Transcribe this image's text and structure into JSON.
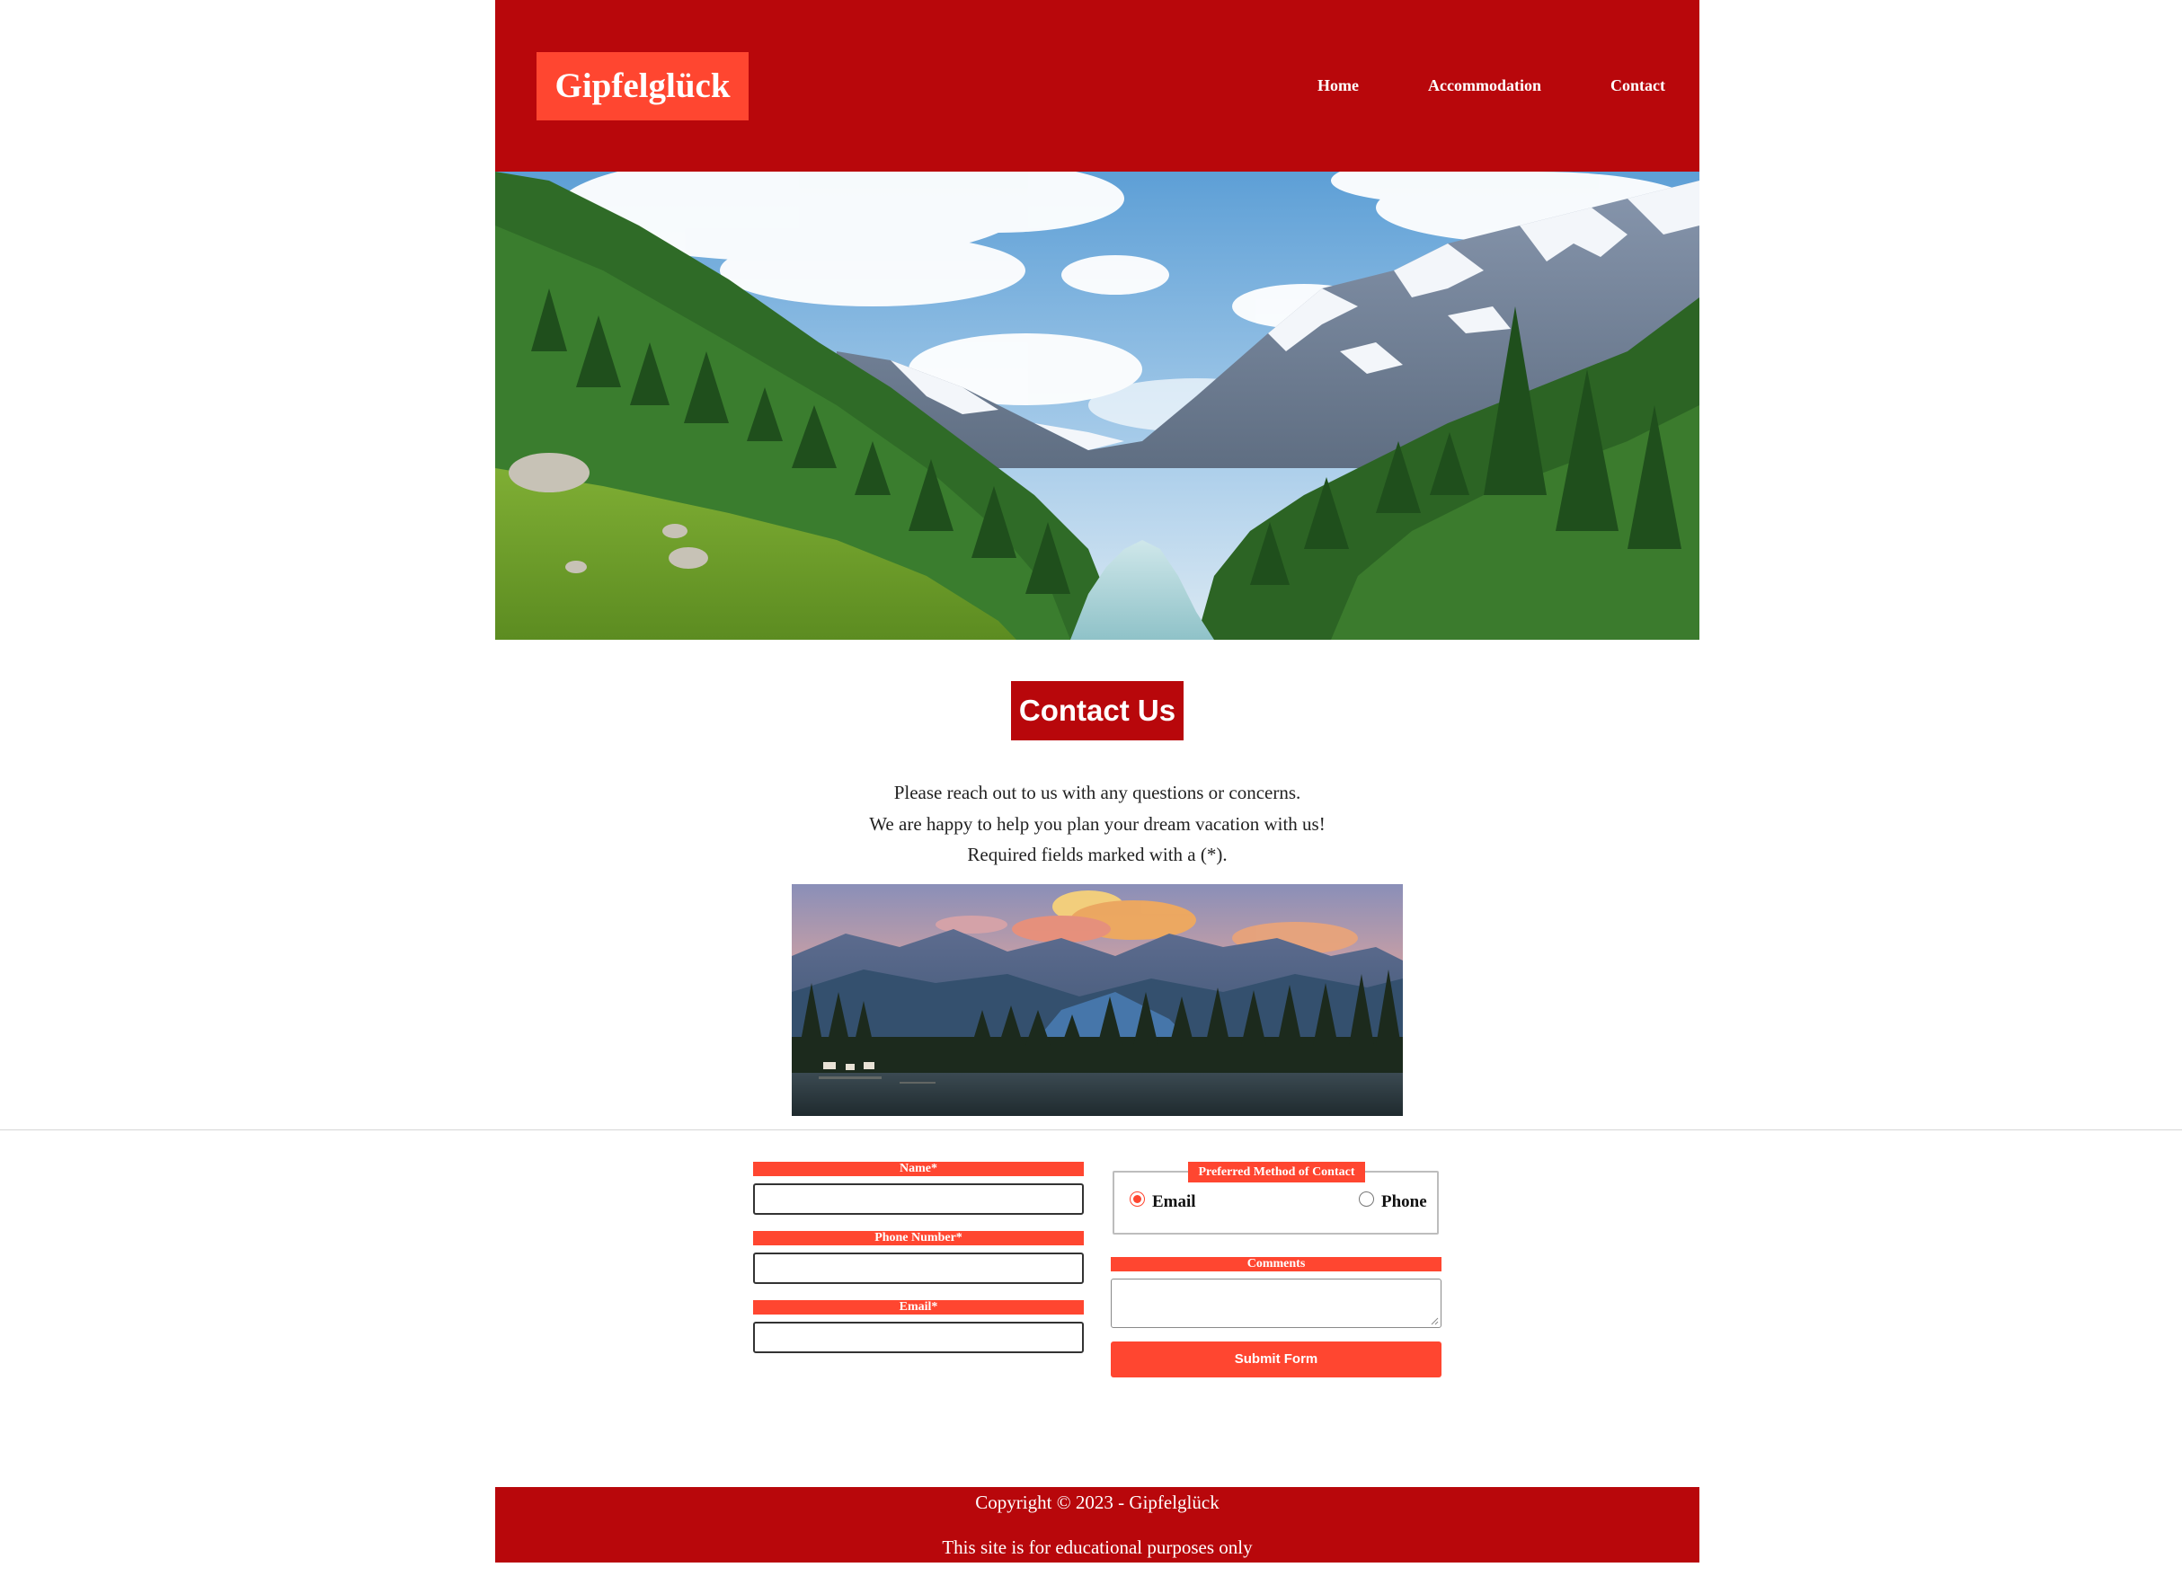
{
  "header": {
    "logo": "Gipfelglück",
    "nav": [
      {
        "label": "Home"
      },
      {
        "label": "Accommodation"
      },
      {
        "label": "Contact"
      }
    ]
  },
  "main": {
    "heading": "Contact Us",
    "intro_lines": [
      "Please reach out to us with any questions or concerns.",
      "We are happy to help you plan your dream vacation with us!",
      "Required fields marked with a (*)."
    ]
  },
  "form": {
    "name_label": "Name*",
    "name_value": "",
    "phone_label": "Phone Number*",
    "phone_value": "",
    "email_label": "Email*",
    "email_value": "",
    "contact_method": {
      "legend": "Preferred Method of Contact",
      "options": [
        {
          "label": "Email",
          "checked": true
        },
        {
          "label": "Phone",
          "checked": false
        }
      ]
    },
    "comments_label": "Comments",
    "comments_value": "",
    "submit_label": "Submit Form"
  },
  "footer": {
    "copyright": "Copyright © 2023 - Gipfelglück",
    "note": "This site is for educational purposes only"
  },
  "colors": {
    "brand_dark_red": "#b8070b",
    "accent_orange_red": "#ff4630",
    "text": "#222222",
    "background": "#ffffff"
  }
}
